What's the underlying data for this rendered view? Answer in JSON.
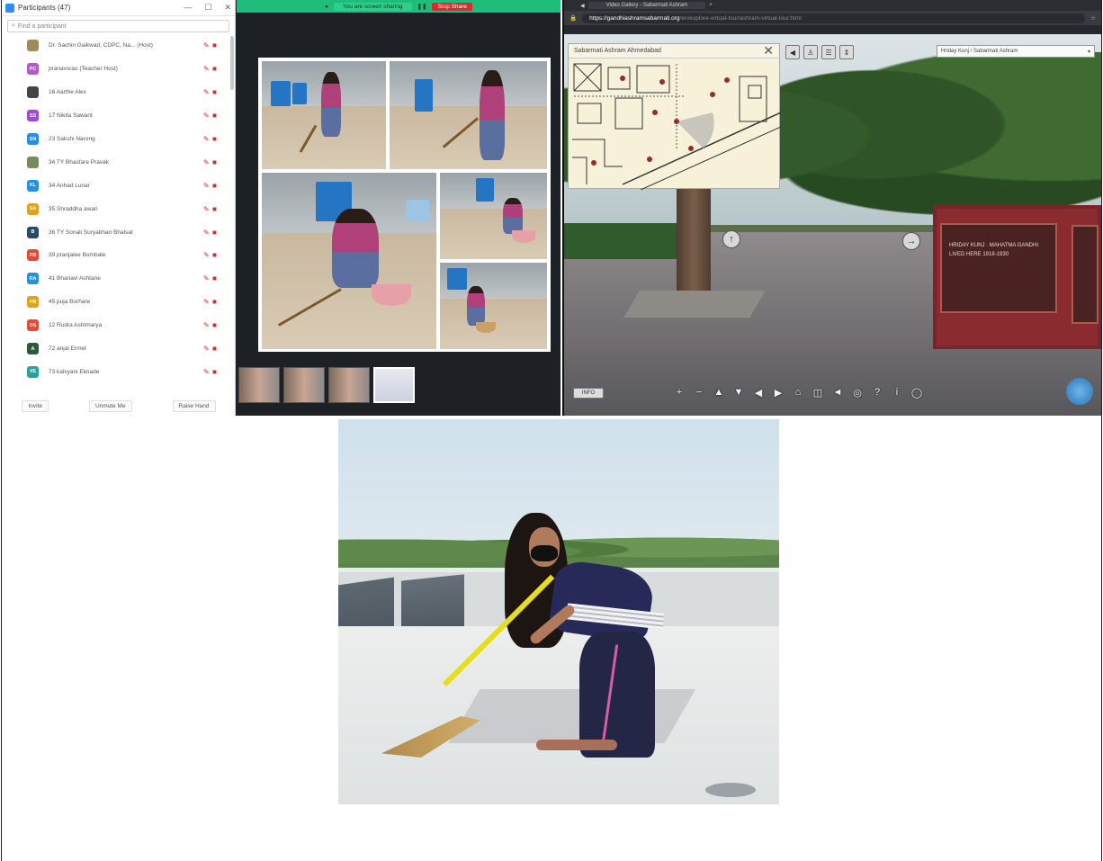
{
  "zoom_window": {
    "title": "Participants (47)",
    "search_placeholder": "Find a participant",
    "participants": [
      {
        "initials": "",
        "name": "Dr. Sachin Gaikwad, CDPC, Na... (Host)",
        "color": "#a08a5a"
      },
      {
        "initials": "PC",
        "name": "pranavsrao (Teacher Host)",
        "color": "#b05cc6"
      },
      {
        "initials": "",
        "name": "16 Aarthe Alex",
        "color": "#444444"
      },
      {
        "initials": "SS",
        "name": "17 Nikita Sawant",
        "color": "#9a4fd0"
      },
      {
        "initials": "SN",
        "name": "23 Sakshi Narong",
        "color": "#2b8de0"
      },
      {
        "initials": "",
        "name": "34 TY Bhasfare Pravak",
        "color": "#7a8a5a"
      },
      {
        "initials": "KL",
        "name": "34 Anhad Lunar",
        "color": "#2b8de0"
      },
      {
        "initials": "SA",
        "name": "35 Shraddha awari",
        "color": "#e0a020"
      },
      {
        "initials": "B",
        "name": "36 TY Sonali Suryabhan Bhalsat",
        "color": "#2b4a6a"
      },
      {
        "initials": "PB",
        "name": "39 pranjalee Bombale",
        "color": "#e04a3a"
      },
      {
        "initials": "RA",
        "name": "41 Bhanavi Ashtane",
        "color": "#2b8de0"
      },
      {
        "initials": "PB",
        "name": "45 puja Borhare",
        "color": "#e0a020"
      },
      {
        "initials": "DS",
        "name": "12 Rudra Ashtmarya",
        "color": "#e04a3a"
      },
      {
        "initials": "A",
        "name": "72 anjal Ermet",
        "color": "#2a5a3a"
      },
      {
        "initials": "VE",
        "name": "73 kalvyani Eknade",
        "color": "#2aa0a0"
      }
    ],
    "footer_buttons": [
      "Invite",
      "Unmute Me",
      "Raise Hand"
    ],
    "share_status": "You are screen sharing",
    "stop_share": "Stop Share"
  },
  "browser": {
    "tab_title": "Video Gallery - Sabarmati Ashram",
    "url_domain": "https://gandhiashramsabarmati.org",
    "url_path": "/en/explore-virtual-tour/ashram-virtual-tour.html",
    "map_title": "Sabarmati Ashram Ahmedabad",
    "dropdown_value": "Hriday Kunj / Sabarmati Ashram",
    "info_button": "INFO",
    "plaque_text": "HRIDAY KUNJ · MAHATMA GANDHI LIVED HERE 1918-1930"
  },
  "colors": {
    "share_green": "#1fbd7c",
    "stop_red": "#e5252a",
    "mute_red": "#e02828"
  }
}
